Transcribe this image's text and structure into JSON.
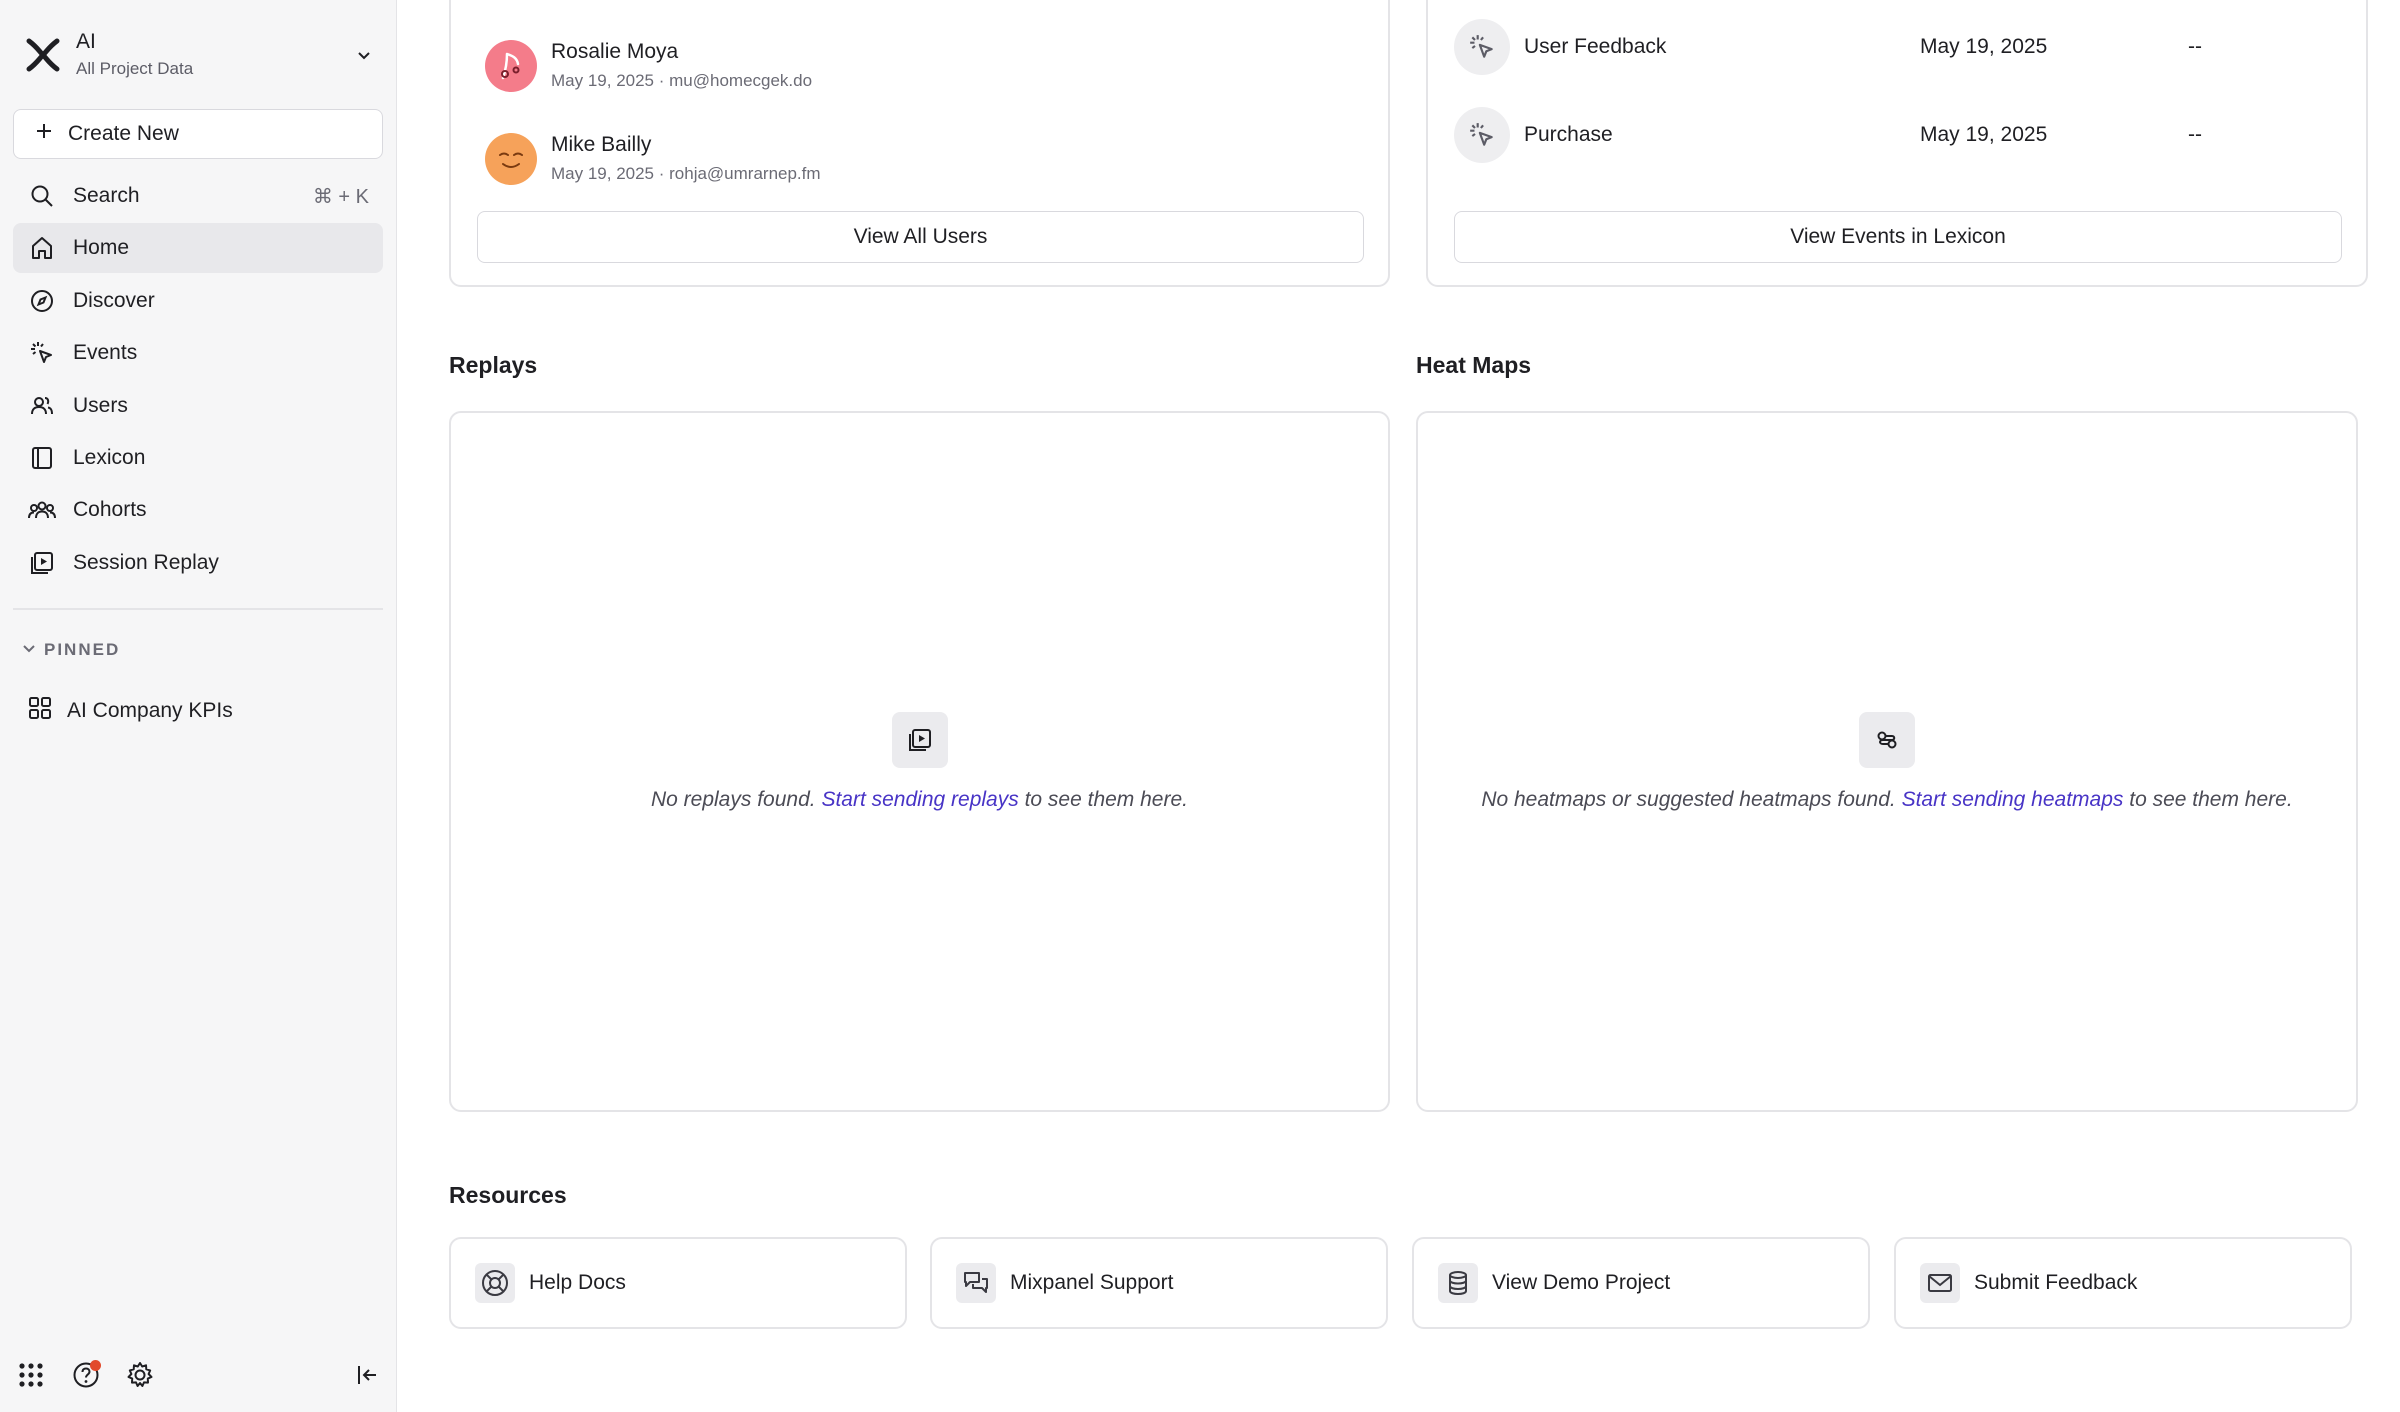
{
  "project": {
    "name": "AI",
    "subtitle": "All Project Data"
  },
  "sidebar": {
    "create_label": "Create New",
    "search": {
      "label": "Search",
      "shortcut": "⌘ + K"
    },
    "items": [
      {
        "label": "Home",
        "icon": "home-icon",
        "active": true
      },
      {
        "label": "Discover",
        "icon": "compass-icon"
      },
      {
        "label": "Events",
        "icon": "cursor-click-icon"
      },
      {
        "label": "Users",
        "icon": "users-icon"
      },
      {
        "label": "Lexicon",
        "icon": "book-icon"
      },
      {
        "label": "Cohorts",
        "icon": "cohorts-icon"
      },
      {
        "label": "Session Replay",
        "icon": "replay-icon"
      }
    ],
    "pinned_header": "PINNED",
    "pinned_items": [
      {
        "label": "AI Company KPIs",
        "icon": "grid-icon"
      }
    ]
  },
  "users_card": {
    "users": [
      {
        "name": "Rosalie Moya",
        "meta": "May 19, 2025 · mu@homecgek.do",
        "avatar_color": "#f47c8a"
      },
      {
        "name": "Mike Bailly",
        "meta": "May 19, 2025 · rohja@umrarnep.fm",
        "avatar_color": "#f6a25a"
      }
    ],
    "button_label": "View All Users"
  },
  "events_card": {
    "events": [
      {
        "name": "User Feedback",
        "date": "May 19, 2025",
        "value": "--"
      },
      {
        "name": "Purchase",
        "date": "May 19, 2025",
        "value": "--"
      }
    ],
    "button_label": "View Events in Lexicon"
  },
  "replays": {
    "title": "Replays",
    "empty_prefix": "No replays found.",
    "empty_link": "Start sending replays",
    "empty_suffix": "to see them here."
  },
  "heatmaps": {
    "title": "Heat Maps",
    "empty_prefix": "No heatmaps or suggested heatmaps found.",
    "empty_link": "Start sending heatmaps",
    "empty_suffix": "to see them here."
  },
  "resources": {
    "title": "Resources",
    "items": [
      {
        "label": "Help Docs",
        "icon": "lifebuoy-icon"
      },
      {
        "label": "Mixpanel Support",
        "icon": "chat-icon"
      },
      {
        "label": "View Demo Project",
        "icon": "database-icon"
      },
      {
        "label": "Submit Feedback",
        "icon": "mail-icon"
      }
    ]
  },
  "colors": {
    "accent_link": "#4834c6",
    "notification": "#e24a2c",
    "sidebar_bg": "#f6f6f7"
  }
}
